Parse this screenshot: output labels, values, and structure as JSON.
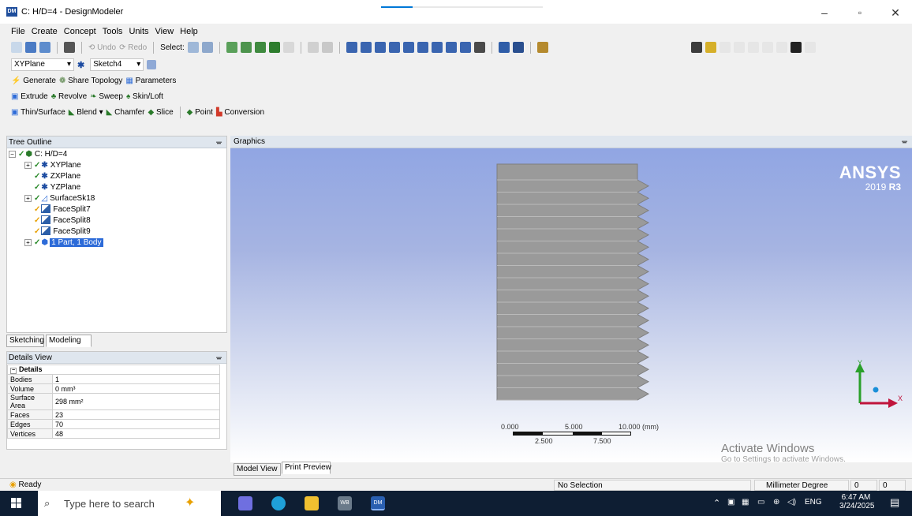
{
  "window": {
    "title": "C: H/D=4 - DesignModeler",
    "app_icon": "DM",
    "minimize": "–",
    "maximize": "▫",
    "close": "✕"
  },
  "menu": [
    "File",
    "Create",
    "Concept",
    "Tools",
    "Units",
    "View",
    "Help"
  ],
  "toolbar1": {
    "undo": "Undo",
    "redo": "Redo",
    "select": "Select:"
  },
  "toolbar2": {
    "plane": "XYPlane",
    "sketch": "Sketch4"
  },
  "toolbar3": {
    "generate": "Generate",
    "share_topology": "Share Topology",
    "parameters": "Parameters"
  },
  "toolbar4": {
    "extrude": "Extrude",
    "revolve": "Revolve",
    "sweep": "Sweep",
    "skin_loft": "Skin/Loft"
  },
  "toolbar5": {
    "thin_surface": "Thin/Surface",
    "blend": "Blend",
    "chamfer": "Chamfer",
    "slice": "Slice",
    "point": "Point",
    "conversion": "Conversion"
  },
  "tree": {
    "header": "Tree Outline",
    "pin": "ᚚ",
    "items": [
      {
        "label": "C: H/D=4"
      },
      {
        "label": "XYPlane"
      },
      {
        "label": "ZXPlane"
      },
      {
        "label": "YZPlane"
      },
      {
        "label": "SurfaceSk18"
      },
      {
        "label": "FaceSplit7"
      },
      {
        "label": "FaceSplit8"
      },
      {
        "label": "FaceSplit9"
      },
      {
        "label": "1 Part, 1 Body"
      }
    ]
  },
  "tabs": {
    "sketching": "Sketching",
    "modeling": "Modeling"
  },
  "details": {
    "header": "Details View",
    "section": "Details",
    "rows": [
      {
        "key": "Bodies",
        "value": "1"
      },
      {
        "key": "Volume",
        "value": "0 mm³"
      },
      {
        "key": "Surface Area",
        "value": "298 mm²"
      },
      {
        "key": "Faces",
        "value": "23"
      },
      {
        "key": "Edges",
        "value": "70"
      },
      {
        "key": "Vertices",
        "value": "48"
      }
    ]
  },
  "graphics": {
    "header": "Graphics",
    "brand": "ANSYS",
    "version_year": "2019",
    "version_rel": "R3",
    "scale": {
      "top_labels": [
        "0.000",
        "5.000",
        "10.000 (mm)"
      ],
      "bottom_labels": [
        "2.500",
        "7.500"
      ]
    },
    "triad": {
      "x": "X",
      "y": "Y"
    },
    "watermark_title": "Activate Windows",
    "watermark_sub": "Go to Settings to activate Windows."
  },
  "bottom_tabs": {
    "model_view": "Model View",
    "print_preview": "Print Preview"
  },
  "status": {
    "ready": "Ready",
    "selection": "No Selection",
    "units": "Millimeter  Degree",
    "v1": "0",
    "v2": "0"
  },
  "taskbar": {
    "search_placeholder": "Type here to search",
    "lang": "ENG",
    "time": "6:47 AM",
    "date": "3/24/2025"
  },
  "colors": {
    "accent": "#2d6bd8",
    "gfx_top": "#8ea4e3",
    "model_fill": "#9a9a9a",
    "taskbar": "#0e1e33"
  }
}
